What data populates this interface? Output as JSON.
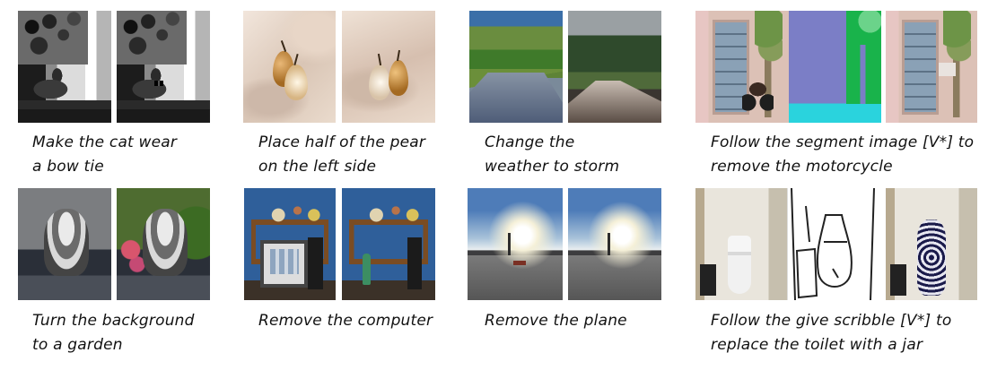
{
  "examples": [
    {
      "caption": [
        "Make the cat wear",
        "a bow tie"
      ]
    },
    {
      "caption": [
        "Place half of the pear",
        "on the left side"
      ]
    },
    {
      "caption": [
        "Change the",
        "weather to storm"
      ]
    },
    {
      "caption": [
        "Follow the segment image [V*] to",
        "remove the motorcycle"
      ]
    },
    {
      "caption": [
        "Turn the background",
        "to a garden"
      ]
    },
    {
      "caption": [
        "Remove the computer"
      ]
    },
    {
      "caption": [
        "Remove the plane"
      ]
    },
    {
      "caption": [
        "Follow the give scribble [V*] to",
        "replace the toilet with a jar"
      ]
    }
  ]
}
